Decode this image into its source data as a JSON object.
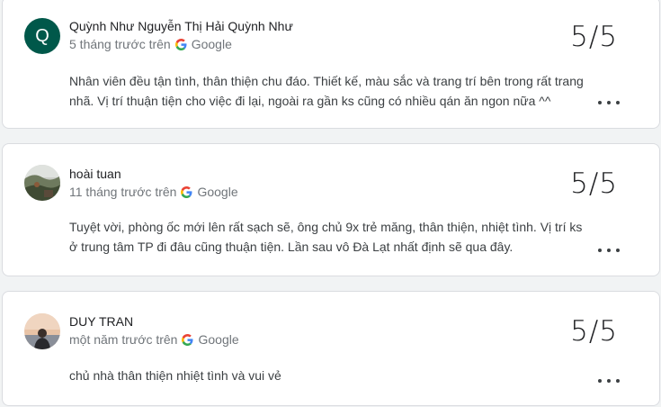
{
  "reviews": [
    {
      "avatar_letter": "Q",
      "name": "Quỳnh Như Nguyễn Thị Hải Quỳnh Như",
      "time": "5 tháng trước trên",
      "source": "Google",
      "score": "5/5",
      "text": "Nhân viên đều tận tình, thân thiện chu đáo. Thiết kế, màu sắc và trang trí bên trong rất trang nhã. Vị trí thuận tiện cho việc đi lại, ngoài ra gần ks cũng có nhiều qán ăn ngon nữa ^^"
    },
    {
      "name": "hoài tuan",
      "time": "11 tháng trước trên",
      "source": "Google",
      "score": "5/5",
      "text": "Tuyệt vời, phòng ốc mới lên rất sạch sẽ, ông chủ 9x trẻ măng, thân thiện, nhiệt tình. Vị trí ks ở trung tâm TP đi đâu cũng thuận tiện. Lần sau vô Đà Lạt nhất định sẽ qua đây."
    },
    {
      "name": "DUY TRAN",
      "time": "một năm trước trên",
      "source": "Google",
      "score": "5/5",
      "text": "chủ nhà thân thiện nhiệt tình và vui vẻ"
    }
  ],
  "icons": {
    "source_logo": "google-g-icon",
    "menu": "more-options-icon"
  },
  "colors": {
    "avatar_bg": "#00584a",
    "meta_text": "#70757a",
    "card_border": "#dadce0"
  }
}
